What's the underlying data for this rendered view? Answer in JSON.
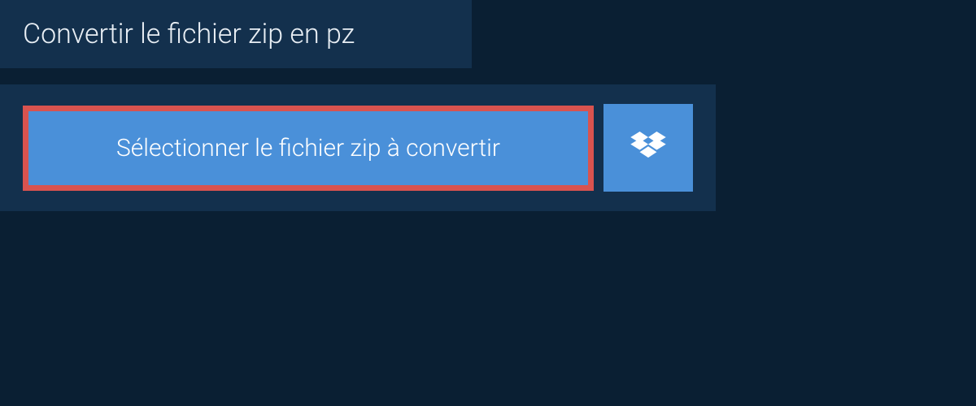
{
  "header": {
    "title": "Convertir le fichier zip en pz"
  },
  "actions": {
    "select_file_label": "Sélectionner le fichier zip à convertir"
  },
  "colors": {
    "background": "#0a1f33",
    "panel": "#13304d",
    "button": "#4a90d9",
    "highlight_border": "#d9534f",
    "text_light": "#ffffff"
  }
}
